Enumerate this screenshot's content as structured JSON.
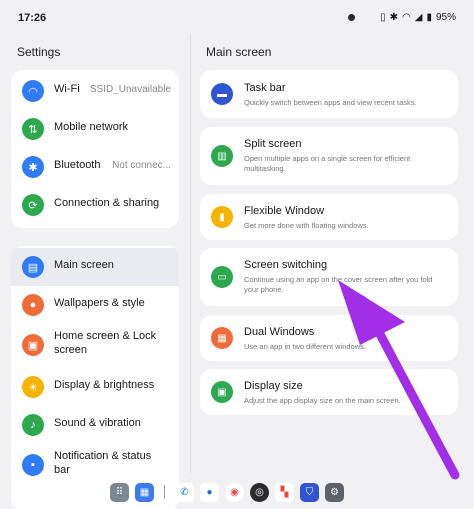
{
  "status": {
    "time": "17:26",
    "battery": "95%",
    "icons": [
      "vibrate-icon",
      "bluetooth-icon",
      "wifi-icon",
      "signal-icon",
      "battery-icon"
    ]
  },
  "left": {
    "title": "Settings",
    "group1": [
      {
        "label": "Wi-Fi",
        "value": "SSID_Unavailable",
        "icon": "wifi-icon",
        "color": "#2f7cf6"
      },
      {
        "label": "Mobile network",
        "value": "",
        "icon": "mobile-network-icon",
        "color": "#2ea84f"
      },
      {
        "label": "Bluetooth",
        "value": "Not connec...",
        "icon": "bluetooth-icon",
        "color": "#2f7cf6"
      },
      {
        "label": "Connection & sharing",
        "value": "",
        "icon": "connection-sharing-icon",
        "color": "#2ea84f"
      }
    ],
    "group2": [
      {
        "label": "Main screen",
        "icon": "main-screen-icon",
        "color": "#2f7cf6"
      },
      {
        "label": "Wallpapers & style",
        "icon": "palette-icon",
        "color": "#f06b3a"
      },
      {
        "label": "Home screen & Lock screen",
        "icon": "home-lock-icon",
        "color": "#f06b3a"
      },
      {
        "label": "Display & brightness",
        "icon": "brightness-icon",
        "color": "#f5b400"
      },
      {
        "label": "Sound & vibration",
        "icon": "bell-icon",
        "color": "#2ea84f"
      },
      {
        "label": "Notification & status bar",
        "icon": "notification-icon",
        "color": "#2f7cf6"
      }
    ]
  },
  "right": {
    "title": "Main screen",
    "items": [
      {
        "title": "Task bar",
        "desc": "Quickly switch between apps and view recent tasks.",
        "icon": "taskbar-icon",
        "color": "#2f55d4"
      },
      {
        "title": "Split screen",
        "desc": "Open multiple apps on a single screen for efficient multitasking.",
        "icon": "split-screen-icon",
        "color": "#2ea84f"
      },
      {
        "title": "Flexible Window",
        "desc": "Get more done with floating windows.",
        "icon": "flexible-window-icon",
        "color": "#f5b400"
      },
      {
        "title": "Screen switching",
        "desc": "Continue using an app on the cover screen after you fold your phone.",
        "icon": "screen-switching-icon",
        "color": "#2ea84f"
      },
      {
        "title": "Dual Windows",
        "desc": "Use an app in two different windows.",
        "icon": "dual-windows-icon",
        "color": "#f06b3a"
      },
      {
        "title": "Display size",
        "desc": "Adjust the app display size on the main screen.",
        "icon": "display-size-icon",
        "color": "#2ea84f"
      }
    ]
  },
  "dock": {
    "apps": [
      {
        "icon": "app-drawer-icon",
        "color": "#7d8794"
      },
      {
        "icon": "files-icon",
        "color": "#3b7bf0"
      },
      {
        "icon": "phone-icon",
        "color": "#1f6de0"
      },
      {
        "icon": "messages-icon",
        "color": "#1f6de0"
      },
      {
        "icon": "chrome-icon",
        "color": "#e8453c"
      },
      {
        "icon": "camera-icon",
        "color": "#2b2b2b"
      },
      {
        "icon": "toolbox-icon",
        "color": "#e8453c"
      },
      {
        "icon": "security-icon",
        "color": "#2f55d4"
      },
      {
        "icon": "settings-gear-icon",
        "color": "#5f6368"
      }
    ]
  },
  "annotation": {
    "color": "#a32ee8"
  }
}
